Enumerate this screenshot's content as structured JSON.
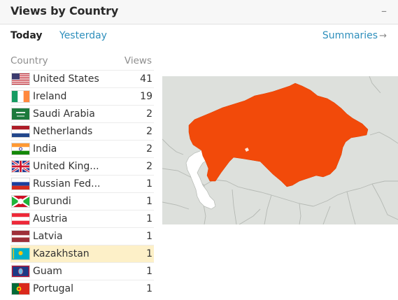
{
  "header": {
    "title": "Views by Country",
    "collapse_label": "–"
  },
  "tabs": [
    {
      "label": "Today",
      "active": true
    },
    {
      "label": "Yesterday",
      "active": false
    }
  ],
  "summaries": {
    "label": "Summaries",
    "arrow": "→"
  },
  "table": {
    "headers": {
      "country": "Country",
      "views": "Views"
    },
    "rows": [
      {
        "country": "United States",
        "views": "41",
        "flag_icon": "us-flag-icon"
      },
      {
        "country": "Ireland",
        "views": "19",
        "flag_icon": "ireland-flag-icon"
      },
      {
        "country": "Saudi Arabia",
        "views": "2",
        "flag_icon": "saudi-arabia-flag-icon"
      },
      {
        "country": "Netherlands",
        "views": "2",
        "flag_icon": "netherlands-flag-icon"
      },
      {
        "country": "India",
        "views": "2",
        "flag_icon": "india-flag-icon"
      },
      {
        "country": "United King...",
        "views": "2",
        "flag_icon": "uk-flag-icon"
      },
      {
        "country": "Russian Fed...",
        "views": "1",
        "flag_icon": "russia-flag-icon"
      },
      {
        "country": "Burundi",
        "views": "1",
        "flag_icon": "burundi-flag-icon"
      },
      {
        "country": "Austria",
        "views": "1",
        "flag_icon": "austria-flag-icon"
      },
      {
        "country": "Latvia",
        "views": "1",
        "flag_icon": "latvia-flag-icon"
      },
      {
        "country": "Kazakhstan",
        "views": "1",
        "flag_icon": "kazakhstan-flag-icon",
        "selected": true
      },
      {
        "country": "Guam",
        "views": "1",
        "flag_icon": "guam-flag-icon"
      },
      {
        "country": "Portugal",
        "views": "1",
        "flag_icon": "portugal-flag-icon"
      }
    ]
  },
  "map": {
    "highlighted_country": "Kazakhstan",
    "colors": {
      "background": "#dde0dc",
      "highlight": "#f24a0a",
      "water": "#ffffff",
      "borders": "#b4b8b3"
    }
  },
  "colors": {
    "link": "#2e8fbc",
    "selected_row": "#fdf0c8"
  }
}
